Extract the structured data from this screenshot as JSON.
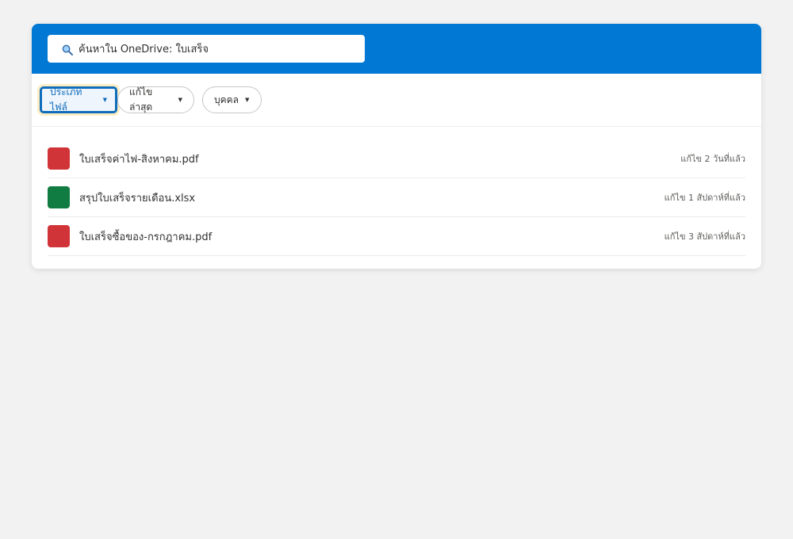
{
  "search": {
    "value": "ค้นหาใน OneDrive: ใบเสร็จ"
  },
  "filters": [
    {
      "label": "ประเภทไฟล์",
      "active": true
    },
    {
      "label": "แก้ไขล่าสุด",
      "active": false
    },
    {
      "label": "บุคคล",
      "active": false
    }
  ],
  "files": [
    {
      "name": "ใบเสร็จค่าไฟ-สิงหาคม.pdf",
      "modified": "แก้ไข 2 วันที่แล้ว",
      "type": "pdf",
      "color": "#d13438"
    },
    {
      "name": "สรุปใบเสร็จรายเดือน.xlsx",
      "modified": "แก้ไข 1 สัปดาห์ที่แล้ว",
      "type": "xlsx",
      "color": "#107c41"
    },
    {
      "name": "ใบเสร็จซื้อของ-กรกฎาคม.pdf",
      "modified": "แก้ไข 3 สัปดาห์ที่แล้ว",
      "type": "pdf",
      "color": "#d13438"
    }
  ],
  "colors": {
    "header": "#0078d4",
    "accent": "#0f6cbd",
    "background": "#f2f2f2"
  },
  "icons": {
    "search": "search-icon",
    "caret": "caret-down-icon"
  }
}
